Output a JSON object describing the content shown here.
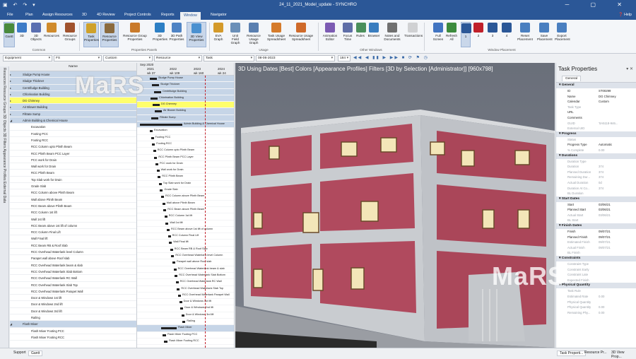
{
  "title": "24_11_2021_Model_update - SYNCHRO",
  "menu": {
    "tabs": [
      "File",
      "Plan",
      "Assign Resources",
      "3D",
      "4D Review",
      "Project Controls",
      "Reports",
      "Window",
      "Navigator"
    ],
    "active_index": 7,
    "help": "Help"
  },
  "ribbon": {
    "buttons": [
      "Gantt",
      "3D",
      "3D Objects",
      "Resources",
      "Resource Groups",
      "Task Properties",
      "Resource Properties",
      "Resource Group Properties",
      "3D Properties",
      "3D Path Properties",
      "3D View Properties",
      "EVA Graph",
      "Unit Field Graph",
      "Resource Usage Graph",
      "Task Usage Spreadsheet",
      "Resource Usage Spreadsheet",
      "Animation Editor",
      "Focus Time",
      "Rules",
      "Browser",
      "Notes and Documents",
      "Transactions",
      "Full Screen",
      "Refresh All",
      "1",
      "2",
      "3",
      "4",
      "Reset Placement",
      "Save Placement",
      "Export Placement"
    ],
    "groups": [
      "Common",
      "Properties Panels",
      "Usage",
      "Other Windows",
      "Window Placement"
    ]
  },
  "fields": {
    "equipment": "Equipment",
    "fs": "FS",
    "custom": "Custom",
    "resource": "Resource",
    "task": "Task",
    "date": "08-06-2023",
    "zoom": "184"
  },
  "vtabs": "Resources  Resource Groups  3D Objects  3D Filters  Appearance Profiles  External Data",
  "tasklist": {
    "header": "Name",
    "rows": [
      {
        "name": "Sludge Pump House",
        "type": "grp"
      },
      {
        "name": "Sludge Thickner",
        "type": "grp"
      },
      {
        "name": "Centrifudge Building",
        "type": "grp"
      },
      {
        "name": "Chlorination Building",
        "type": "grp"
      },
      {
        "name": "DG Chimney",
        "type": "hl"
      },
      {
        "name": "Air Blower Building",
        "type": "grp"
      },
      {
        "name": "Filtrate Sump",
        "type": "grp"
      },
      {
        "name": "Admin Building & Chemical House",
        "type": "grp"
      },
      {
        "name": "Excavation",
        "type": "t"
      },
      {
        "name": "Footing PCC",
        "type": "t"
      },
      {
        "name": "Footing RCC",
        "type": "t"
      },
      {
        "name": "RCC Column upto Plinth Beam",
        "type": "t"
      },
      {
        "name": "RCC Plinth Beam PCC Layer",
        "type": "t"
      },
      {
        "name": "PCC work for Drain",
        "type": "t"
      },
      {
        "name": "Wall work for Drain",
        "type": "t"
      },
      {
        "name": "RCC Plinth Beam",
        "type": "t"
      },
      {
        "name": "Top Slab work for Drain",
        "type": "t"
      },
      {
        "name": "Grade Slab",
        "type": "t"
      },
      {
        "name": "RCC Column above Plinth Beam",
        "type": "t"
      },
      {
        "name": "Wall above Plinth Beam",
        "type": "t"
      },
      {
        "name": "RCC Beam above Plinth Beam",
        "type": "t"
      },
      {
        "name": "RCC Column 1st lift",
        "type": "t"
      },
      {
        "name": "Wall 1st lift",
        "type": "t"
      },
      {
        "name": "RCC Beam above 1st lift of column",
        "type": "t"
      },
      {
        "name": "RCC Column Final Lift",
        "type": "t"
      },
      {
        "name": "Wall Final lift",
        "type": "t"
      },
      {
        "name": "RCC Beam RB & Roof Slab",
        "type": "t"
      },
      {
        "name": "RCC Overhead Waterlank level Column",
        "type": "t"
      },
      {
        "name": "Parapet wall above Roof slab",
        "type": "t"
      },
      {
        "name": "RCC Overhead Waterlank beam & slab",
        "type": "t"
      },
      {
        "name": "RCC Overhead Waterlank Slab Bottom",
        "type": "t"
      },
      {
        "name": "RCC Overhead Waterlank RC Wall",
        "type": "t"
      },
      {
        "name": "RCC Overhead Waterlank Slab Top",
        "type": "t"
      },
      {
        "name": "RCC Overhead Waterlank Parapet Wall",
        "type": "t"
      },
      {
        "name": "Door & Windows 1st lift",
        "type": "t"
      },
      {
        "name": "Door & Windows 2nd lift",
        "type": "t"
      },
      {
        "name": "Door & Windows 3rd lift",
        "type": "t"
      },
      {
        "name": "Railing",
        "type": "t"
      },
      {
        "name": "Flash Mixer",
        "type": "grp"
      },
      {
        "name": "Flash Mixer Footing PCC",
        "type": "t"
      },
      {
        "name": "Flash Mixer Footing RCC",
        "type": "t"
      }
    ]
  },
  "gantt": {
    "month": "Sep 2020",
    "years": [
      "2021",
      "2022",
      "2023",
      "2024"
    ],
    "weeks": [
      "wk 37",
      "wk 109",
      "wk 160",
      "wk 24"
    ]
  },
  "view3d": {
    "title": "3D Using Dates [Best] Colors [Appearance Profiles] Filters [3D by Selection [Administrator]]  [960x798]",
    "watermark": "MaRS"
  },
  "props": {
    "title": "Task Properties",
    "tab": "General",
    "sections": [
      {
        "name": "General",
        "rows": [
          [
            "ID",
            "ST00299",
            0
          ],
          [
            "Name",
            "DG Chimney",
            0
          ],
          [
            "Calendar",
            "Custom",
            0
          ],
          [
            "Task Type",
            "",
            1
          ],
          [
            "URL",
            "",
            0
          ],
          [
            "Comments",
            "",
            0
          ],
          [
            "GUID",
            "'0A5118-946...",
            1
          ],
          [
            "External UID",
            "",
            1
          ]
        ]
      },
      {
        "name": "Progress",
        "rows": [
          [
            "Status",
            "",
            1
          ],
          [
            "Progress Type",
            "Automatic",
            0
          ],
          [
            "% Complete",
            "0.00",
            1
          ]
        ]
      },
      {
        "name": "Durations",
        "rows": [
          [
            "Duration Type",
            "",
            1
          ],
          [
            "Duration",
            "374",
            1
          ],
          [
            "Planned Duration",
            "374",
            1
          ],
          [
            "Remaining Dur...",
            "374",
            1
          ],
          [
            "Actual Duration",
            "0d",
            1
          ],
          [
            "Duration At Co...",
            "374",
            1
          ],
          [
            "BL Duration",
            "",
            1
          ]
        ]
      },
      {
        "name": "Start Dates",
        "rows": [
          [
            "Start",
            "03/06/21",
            0
          ],
          [
            "Planned Start",
            "03/06/21",
            0
          ],
          [
            "Actual Start",
            "03/06/21",
            1
          ],
          [
            "BL Start",
            "",
            1
          ]
        ]
      },
      {
        "name": "Finish Dates",
        "rows": [
          [
            "Finish",
            "09/07/21",
            0
          ],
          [
            "Planned Finish",
            "09/07/21",
            0
          ],
          [
            "Estimated Finish",
            "09/07/21",
            1
          ],
          [
            "Actual Finish",
            "09/07/21",
            1
          ],
          [
            "BL Finish",
            "",
            1
          ]
        ]
      },
      {
        "name": "Constraints",
        "rows": [
          [
            "Constraint Type",
            "",
            1
          ],
          [
            "Constraint Early",
            "",
            1
          ],
          [
            "Constraint Late",
            "",
            1
          ],
          [
            "Expected Finish",
            "",
            1
          ]
        ]
      },
      {
        "name": "Physical Quantity",
        "rows": [
          [
            "Task Rule",
            "",
            1
          ],
          [
            "Estimated Rate",
            "0.00",
            1
          ],
          [
            "Physical Quantity",
            "",
            1
          ],
          [
            "Physical Quantity",
            "0.00",
            1
          ],
          [
            "Remaining Phy...",
            "0.00",
            1
          ]
        ]
      }
    ]
  },
  "status": {
    "left_tabs": [
      "Support",
      "Gantt"
    ],
    "right_tabs": [
      "Task Properti...",
      "Resource Pr...",
      "3D View Prop..."
    ]
  },
  "colors": {
    "ribbon_blue": "#2b5797",
    "highlight": "#ffff6b",
    "group_row": "#c6d5e7",
    "wall_pink": "#b04a5e",
    "frame_grey": "#c9ccd0",
    "now_line": "#c0202a"
  }
}
